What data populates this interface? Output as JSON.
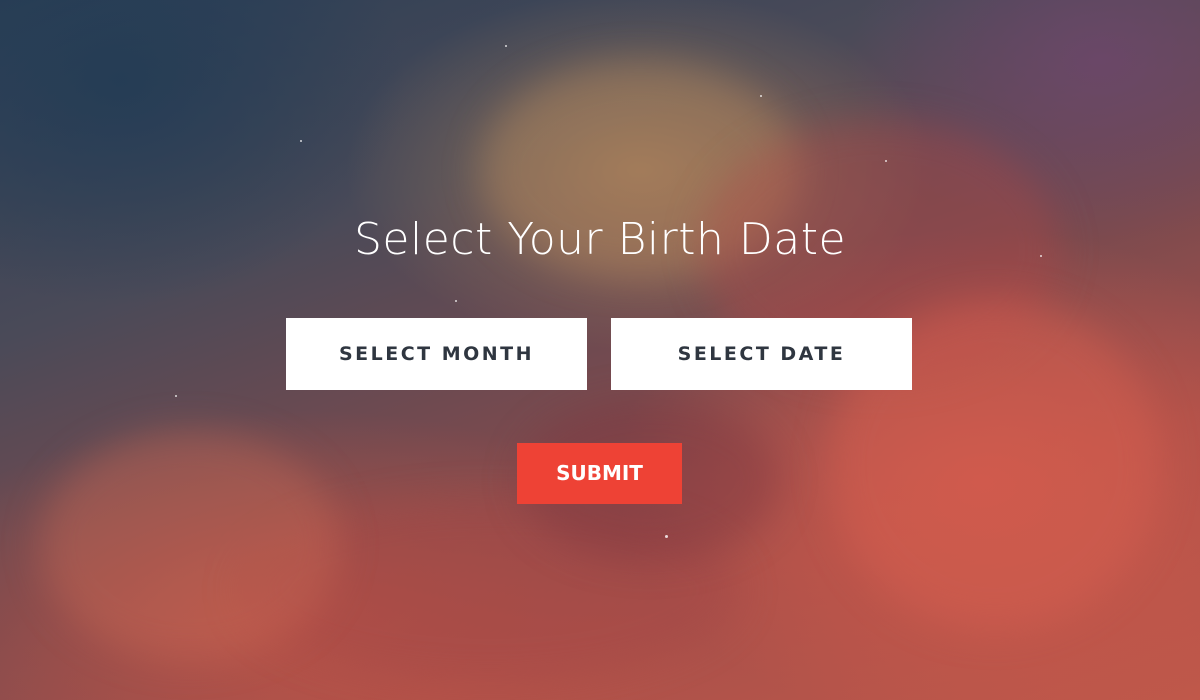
{
  "title": "Select Your Birth Date",
  "month_button": {
    "label": "SELECT MONTH"
  },
  "date_button": {
    "label": "SELECT DATE"
  },
  "submit_button": {
    "label": "SUBMIT"
  },
  "colors": {
    "submit_bg": "#ee4235",
    "select_bg": "#ffffff",
    "select_text": "#2f3640",
    "title_text": "#ffffff"
  }
}
